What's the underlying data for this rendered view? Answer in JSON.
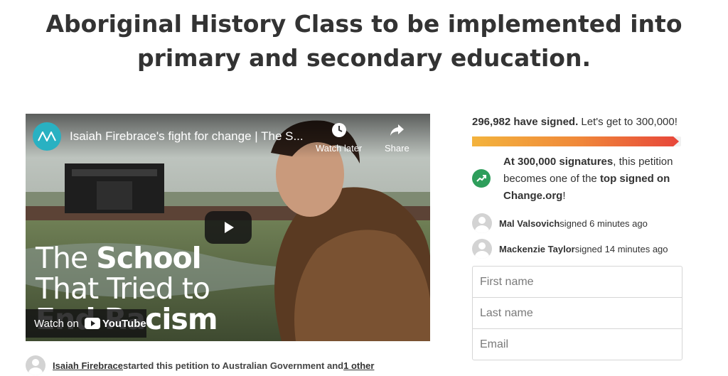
{
  "page": {
    "title_line1": "Aboriginal History Class to be implemented into",
    "title_line2": "primary and secondary education."
  },
  "video": {
    "title": "Isaiah Firebrace's fight for change | The S...",
    "watch_later": "Watch later",
    "share": "Share",
    "overlay_line1_light": "The ",
    "overlay_line1_bold": "School",
    "overlay_line2": "That Tried to",
    "overlay_line3": "End Racism",
    "watch_on": "Watch on",
    "youtube": "YouTube",
    "icons": [
      "abc-logo-icon",
      "clock-icon",
      "share-icon",
      "play-icon",
      "youtube-icon"
    ]
  },
  "starter": {
    "name": "Isaiah Firebrace",
    "text": " started this petition to Australian Government and ",
    "other": "1 other"
  },
  "signatures": {
    "count": "296,982 have signed.",
    "cta": " Let's get to 300,000!",
    "progress_fraction": 0.99,
    "milestone_bold": "At 300,000 signatures",
    "milestone_text": ", this petition becomes one of the ",
    "milestone_bold2": "top signed on Change.org",
    "milestone_end": "!"
  },
  "recent_signers": [
    {
      "name": "Mal Valsovich",
      "action": " signed 6 minutes ago"
    },
    {
      "name": "Mackenzie Taylor",
      "action": " signed 14 minutes ago"
    }
  ],
  "form": {
    "first_name_placeholder": "First name",
    "last_name_placeholder": "Last name",
    "email_placeholder": "Email"
  },
  "colors": {
    "progress_start": "#f3b33d",
    "progress_end": "#e7463a",
    "trend_green": "#2e9e5b",
    "abc_teal": "#29b1c2"
  }
}
